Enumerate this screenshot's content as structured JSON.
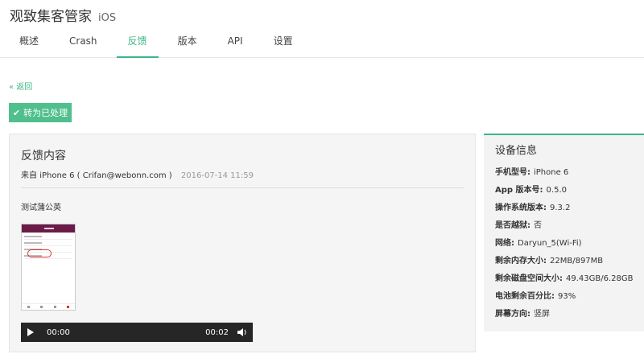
{
  "app": {
    "title": "观致集客管家",
    "platform": "iOS"
  },
  "tabs": [
    {
      "label": "概述"
    },
    {
      "label": "Crash"
    },
    {
      "label": "反馈"
    },
    {
      "label": "版本"
    },
    {
      "label": "API"
    },
    {
      "label": "设置"
    }
  ],
  "active_tab": "反馈",
  "back_label": "« 返回",
  "mark_button_label": "转为已处理",
  "feedback": {
    "title": "反馈内容",
    "from_prefix": "来自",
    "from": "iPhone 6 ( Crifan@webonn.com )",
    "time": "2016-07-14 11:59",
    "message": "测试蒲公英"
  },
  "audio": {
    "current": "00:00",
    "duration": "00:02"
  },
  "device": {
    "title": "设备信息",
    "rows": [
      {
        "label": "手机型号:",
        "value": "iPhone 6"
      },
      {
        "label": "App 版本号:",
        "value": "0.5.0"
      },
      {
        "label": "操作系统版本:",
        "value": "9.3.2"
      },
      {
        "label": "是否越狱:",
        "value": "否"
      },
      {
        "label": "网络:",
        "value": "Daryun_5(Wi-Fi)"
      },
      {
        "label": "剩余内存大小:",
        "value": "22MB/897MB"
      },
      {
        "label": "剩余磁盘空间大小:",
        "value": "49.43GB/6.28GB"
      },
      {
        "label": "电池剩余百分比:",
        "value": "93%"
      },
      {
        "label": "屏幕方向:",
        "value": "竖屏"
      }
    ]
  },
  "colors": {
    "accent": "#3cb685",
    "button": "#4fbf8d",
    "player": "#262626"
  }
}
